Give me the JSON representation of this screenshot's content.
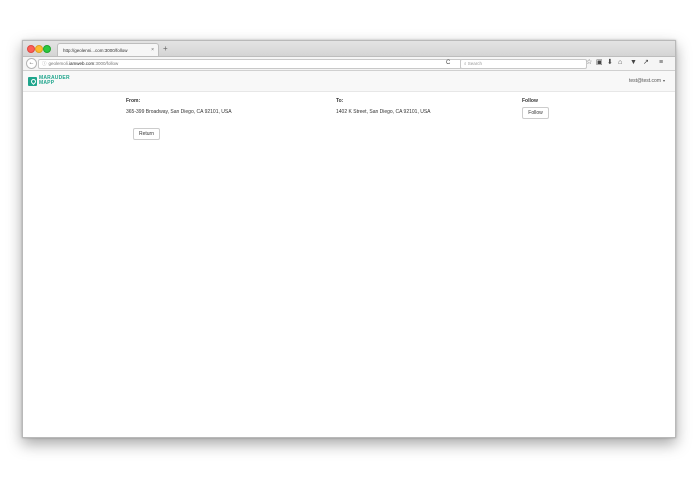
{
  "browser": {
    "tab_title": "http://geolenni...com:3000/follow",
    "tab_close": "×",
    "new_tab": "+",
    "back": "←",
    "url_info_icon": "ⓘ",
    "url_prefix": "geolemoli.",
    "url_domain": "iamweb.com",
    "url_path": ":3000/follow",
    "reload": "C",
    "search_placeholder": "Search",
    "search_icon": "🔍",
    "toolbar_icons": {
      "bookmark_star": "☆",
      "reading_list": "▣",
      "download": "⬇",
      "home": "⌂",
      "pocket": "▼",
      "share": "↗",
      "menu": "≡"
    }
  },
  "app": {
    "logo_line1": "MARAUDER",
    "logo_line2": "MAPP",
    "brand_color": "#1fa58c",
    "user_email": "test@test.com",
    "user_caret": "▾"
  },
  "route": {
    "from_label": "From:",
    "from_value": "365-399 Broadway, San Diego, CA 92101, USA",
    "to_label": "To:",
    "to_value": "1402 K Street, San Diego, CA 92101, USA",
    "follow_label": "Follow",
    "follow_button": "Follow",
    "return_button": "Return"
  }
}
